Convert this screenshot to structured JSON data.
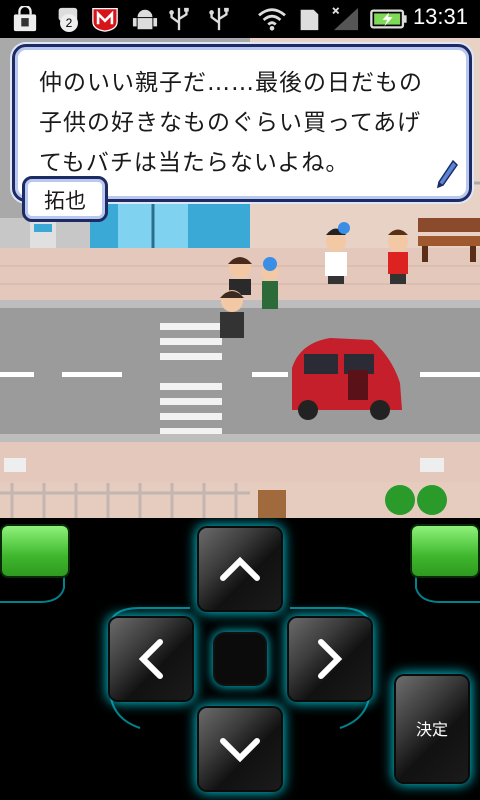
{
  "status_bar": {
    "notification_count": "2",
    "time": "13:31"
  },
  "dialog": {
    "lines": [
      "仲のいい親子だ……最後の日だもの",
      "子供の好きなものぐらい買ってあげ",
      "てもバチは当たらないよね。"
    ],
    "speaker": "拓也"
  },
  "controller": {
    "decide_label": "決定"
  },
  "colors": {
    "glow": "#00c8d8",
    "green_button": "#3fb72d",
    "dialog_border": "#1d2a64"
  }
}
